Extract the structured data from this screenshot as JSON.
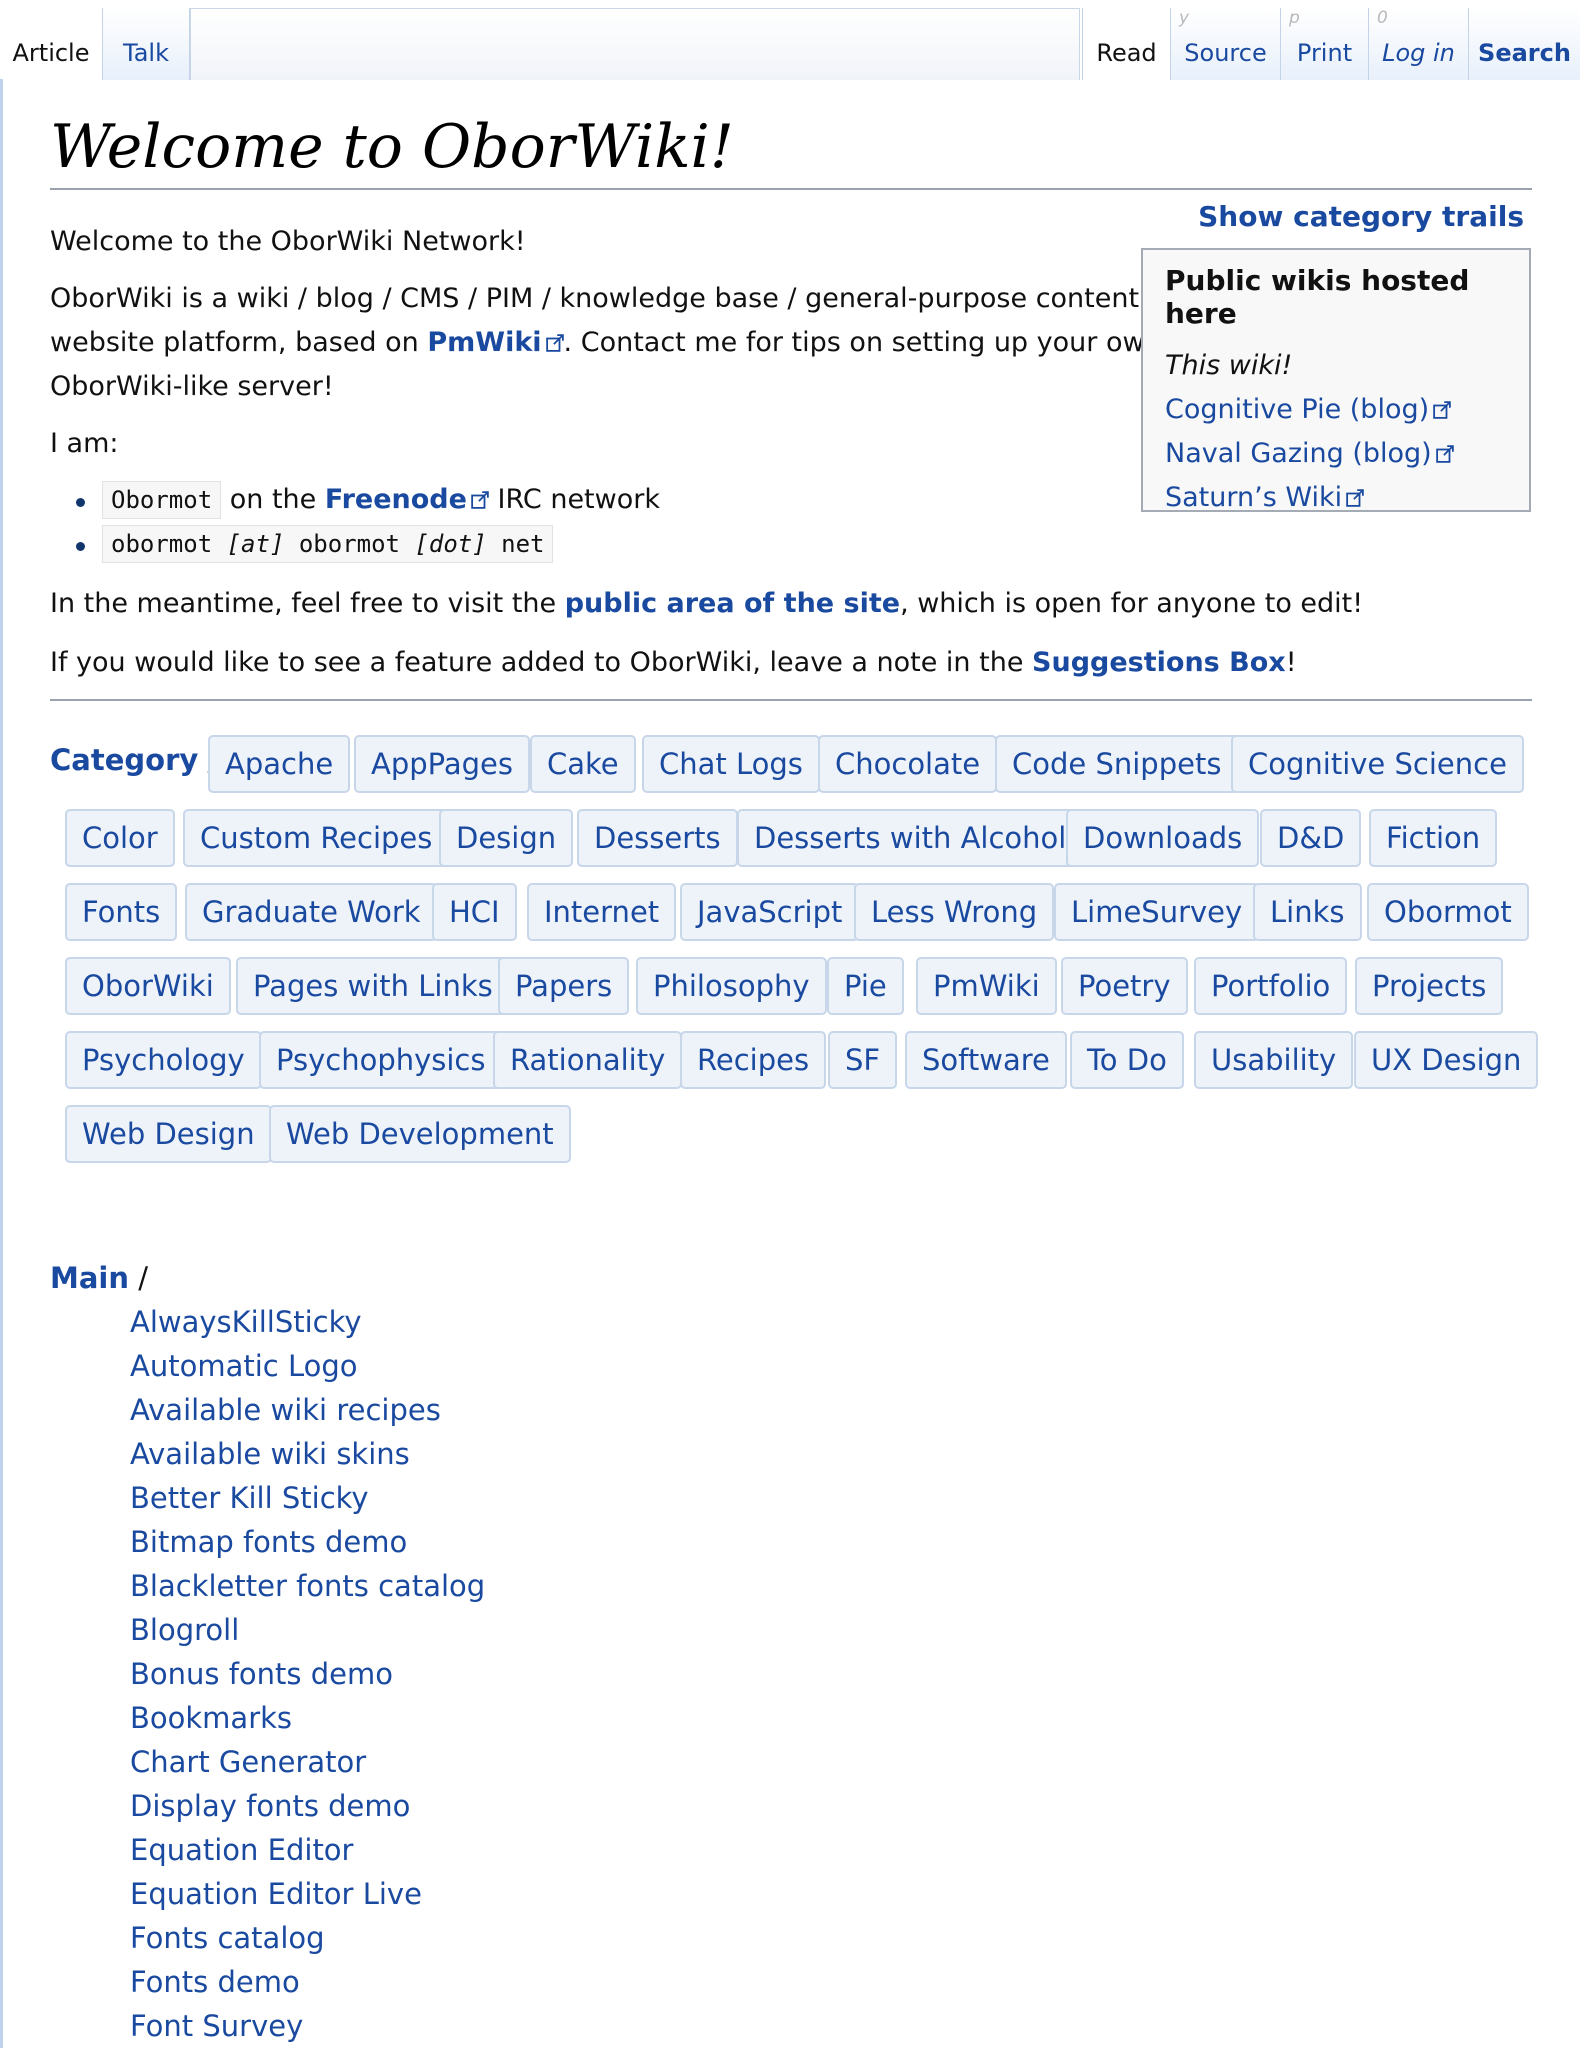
{
  "tabs": {
    "article": "Article",
    "talk": "Talk",
    "read": "Read",
    "source": "Source",
    "source_key": "y",
    "print": "Print",
    "print_key": "p",
    "login": "Log in",
    "login_key": "0",
    "search": "Search"
  },
  "page_title": "Welcome to OborWiki!",
  "show_category_trails": "Show category trails",
  "intro": {
    "welcome": "Welcome to the OborWiki Network!",
    "desc_1": "OborWiki is a wiki / blog / CMS / PIM / knowledge base / general-purpose content",
    "desc_2a": "website platform, based on ",
    "desc_pmwiki": "PmWiki",
    "desc_2b": ". Contact me for tips on setting up your own",
    "desc_3": "OborWiki-like server!",
    "iam": "I am:",
    "irc_code": "Obormot",
    "irc_mid": " on the ",
    "irc_link": "Freenode",
    "irc_end": " IRC network",
    "email_a": "obormot ",
    "email_at": "[at]",
    "email_b": " obormot ",
    "email_dot": "[dot]",
    "email_c": " net",
    "meantime_a": "In the meantime, feel free to visit the ",
    "meantime_link": "public area of the site",
    "meantime_b": ", which is open for anyone to edit!",
    "suggest_a": "If you would like to see a feature added to OborWiki, leave a note in the ",
    "suggest_link": "Suggestions Box",
    "suggest_b": "!"
  },
  "sidebox": {
    "heading": "Public wikis hosted here",
    "this_wiki": "This wiki!",
    "links": [
      "Cognitive Pie (blog)",
      "Naval Gazing (blog)",
      "Saturn’s Wiki"
    ]
  },
  "category": {
    "label": "Category",
    "slash": " /",
    "tags": [
      "Apache",
      "AppPages",
      "Cake",
      "Chat Logs",
      "Chocolate",
      "Code Snippets",
      "Cognitive Science",
      "Color",
      "Custom Recipes",
      "Design",
      "Desserts",
      "Desserts with Alcohol",
      "Downloads",
      "D&D",
      "Fiction",
      "Fonts",
      "Graduate Work",
      "HCI",
      "Internet",
      "JavaScript",
      "Less Wrong",
      "LimeSurvey",
      "Links",
      "Obormot",
      "OborWiki",
      "Pages with Links",
      "Papers",
      "Philosophy",
      "Pie",
      "PmWiki",
      "Poetry",
      "Portfolio",
      "Projects",
      "Psychology",
      "Psychophysics",
      "Rationality",
      "Recipes",
      "SF",
      "Software",
      "To Do",
      "Usability",
      "UX Design",
      "Web Design",
      "Web Development"
    ]
  },
  "main": {
    "label": "Main",
    "slash": " /",
    "pages": [
      "AlwaysKillSticky",
      "Automatic Logo",
      "Available wiki recipes",
      "Available wiki skins",
      "Better Kill Sticky",
      "Bitmap fonts demo",
      "Blackletter fonts catalog",
      "Blogroll",
      "Bonus fonts demo",
      "Bookmarks",
      "Chart Generator",
      "Display fonts demo",
      "Equation Editor",
      "Equation Editor Live",
      "Fonts catalog",
      "Fonts demo",
      "Font Survey"
    ]
  }
}
